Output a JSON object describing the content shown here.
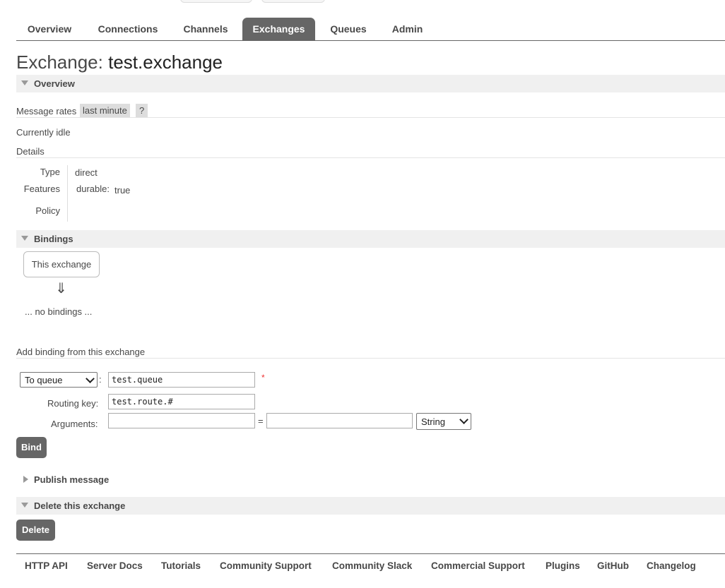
{
  "nav": {
    "tabs": [
      {
        "label": "Overview"
      },
      {
        "label": "Connections"
      },
      {
        "label": "Channels"
      },
      {
        "label": "Exchanges"
      },
      {
        "label": "Queues"
      },
      {
        "label": "Admin"
      }
    ],
    "active": "Exchanges"
  },
  "page": {
    "title_prefix": "Exchange:",
    "exchange_name": "test.exchange"
  },
  "overview": {
    "heading": "Overview",
    "message_rates_label": "Message rates",
    "message_rates_period": "last minute",
    "help": "?",
    "status": "Currently idle",
    "details_heading": "Details",
    "type_label": "Type",
    "type_value": "direct",
    "features_label": "Features",
    "feature_key": "durable:",
    "feature_value": "true",
    "policy_label": "Policy"
  },
  "bindings": {
    "heading": "Bindings",
    "this_exchange": "This exchange",
    "arrow": "⇓",
    "empty": "... no bindings ..."
  },
  "add_binding": {
    "heading": "Add binding from this exchange",
    "destination_type": "To queue",
    "colon": ":",
    "destination_value": "test.queue",
    "required_mark": "*",
    "routing_key_label": "Routing key:",
    "routing_key_value": "test.route.#",
    "arguments_label": "Arguments:",
    "argument_key": "",
    "equals": "=",
    "argument_value": "",
    "argument_type": "String",
    "bind_button": "Bind"
  },
  "publish": {
    "heading": "Publish message"
  },
  "delete": {
    "heading": "Delete this exchange",
    "button": "Delete"
  },
  "footer": {
    "links": [
      "HTTP API",
      "Server Docs",
      "Tutorials",
      "Community Support",
      "Community Slack",
      "Commercial Support",
      "Plugins",
      "GitHub",
      "Changelog"
    ]
  }
}
